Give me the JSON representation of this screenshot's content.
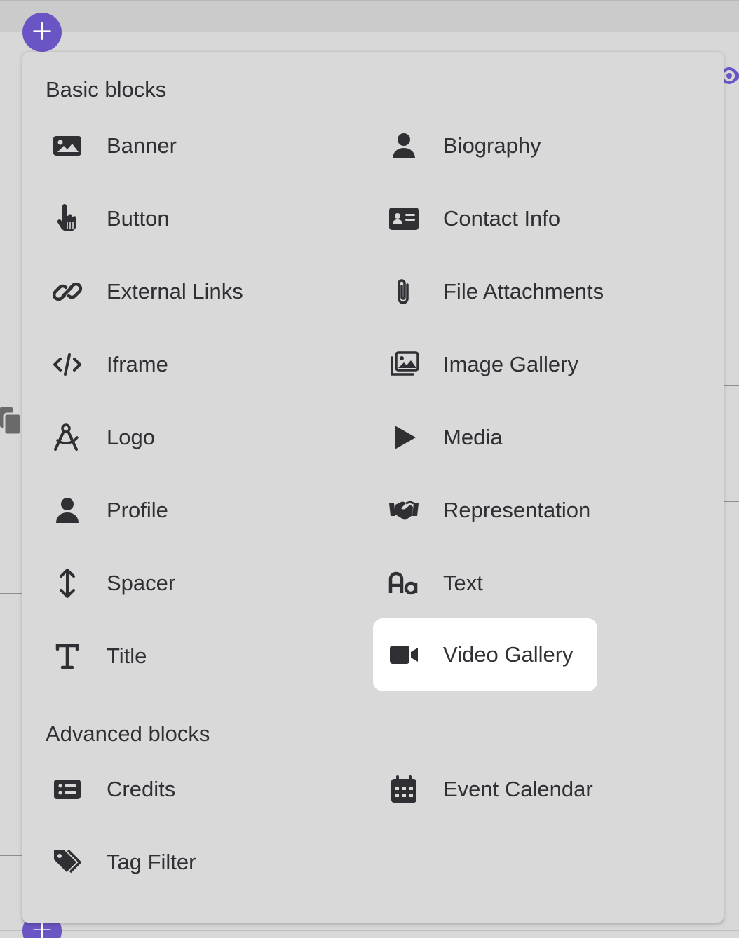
{
  "fab": {
    "symbol": "+"
  },
  "menu": {
    "sections": [
      {
        "title": "Basic blocks",
        "items": [
          {
            "label": "Banner",
            "icon": "image-icon"
          },
          {
            "label": "Biography",
            "icon": "user-icon"
          },
          {
            "label": "Button",
            "icon": "pointer-hand-icon"
          },
          {
            "label": "Contact Info",
            "icon": "id-card-icon"
          },
          {
            "label": "External Links",
            "icon": "link-icon"
          },
          {
            "label": "File Attachments",
            "icon": "paperclip-icon"
          },
          {
            "label": "Iframe",
            "icon": "code-icon"
          },
          {
            "label": "Image Gallery",
            "icon": "images-icon"
          },
          {
            "label": "Logo",
            "icon": "compass-drafting-icon"
          },
          {
            "label": "Media",
            "icon": "play-icon"
          },
          {
            "label": "Profile",
            "icon": "user-icon"
          },
          {
            "label": "Representation",
            "icon": "handshake-icon"
          },
          {
            "label": "Spacer",
            "icon": "arrows-up-down-icon"
          },
          {
            "label": "Text",
            "icon": "font-case-icon"
          },
          {
            "label": "Title",
            "icon": "text-title-icon"
          },
          {
            "label": "Video Gallery",
            "icon": "video-camera-icon",
            "highlighted": true
          }
        ]
      },
      {
        "title": "Advanced blocks",
        "items": [
          {
            "label": "Credits",
            "icon": "list-card-icon"
          },
          {
            "label": "Event Calendar",
            "icon": "calendar-icon"
          },
          {
            "label": "Tag Filter",
            "icon": "tags-icon"
          }
        ]
      }
    ]
  },
  "colors": {
    "accent": "#6b55c4",
    "text": "#2f2f34",
    "menu_bg": "#d9d9d9",
    "highlight_bg": "#ffffff"
  }
}
